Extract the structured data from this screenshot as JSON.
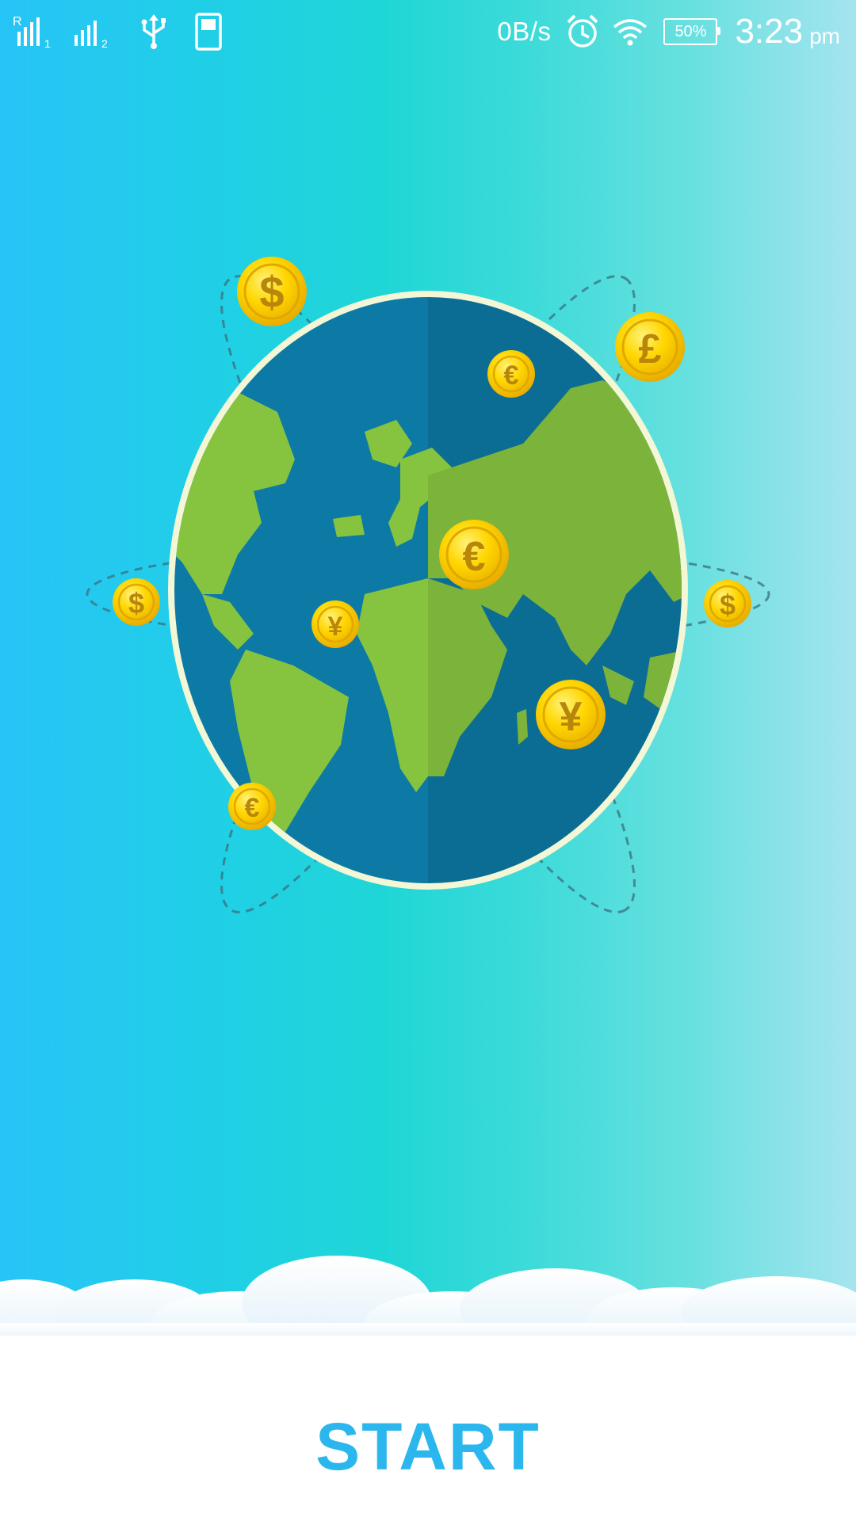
{
  "status_bar": {
    "signal_1": "signal-strength-sim1-icon",
    "signal_2": "signal-strength-sim2-icon",
    "usb": "usb-icon",
    "notification": "app-notification-icon",
    "net_speed": "0B/s",
    "alarm": "alarm-clock-icon",
    "wifi": "wifi-icon",
    "battery": "50%",
    "time": "3:23",
    "ampm": "pm"
  },
  "illustration": {
    "name": "globe-currency-illustration",
    "coins": [
      "$",
      "£",
      "€",
      "€",
      "$",
      "¥",
      "$",
      "¥",
      "€"
    ]
  },
  "start_button": {
    "label": "START"
  },
  "colors": {
    "gradient_left": "#27c4f7",
    "gradient_mid": "#1fd6d6",
    "gradient_right": "#a5e4ef",
    "accent": "#2bb7ee",
    "ocean": "#0e76a0",
    "land": "#8ac43f",
    "coin": "#f5c400"
  }
}
